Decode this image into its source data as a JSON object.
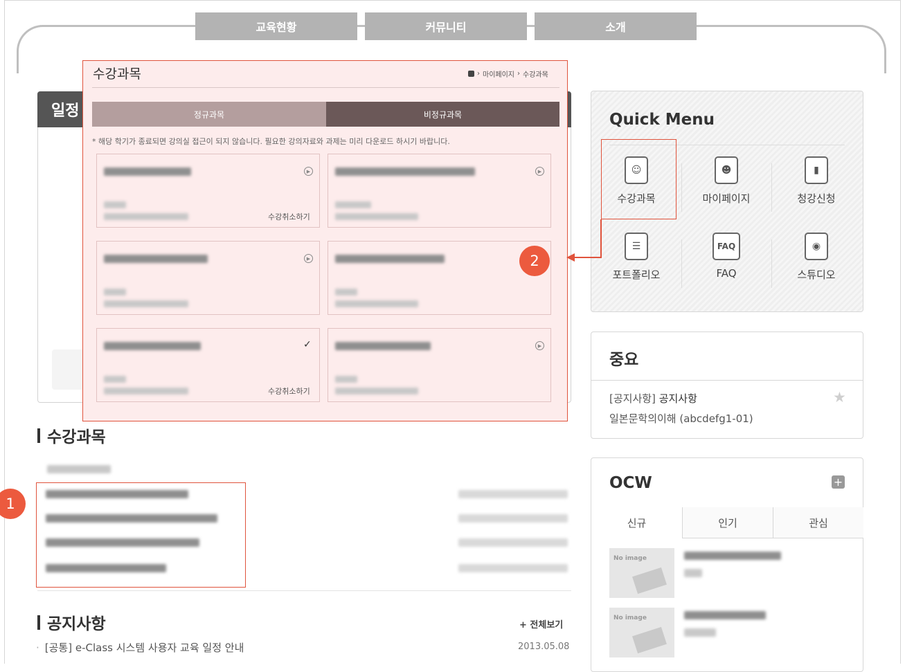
{
  "nav": {
    "tabs": [
      "교육현황",
      "커뮤니티",
      "소개"
    ]
  },
  "schedule": {
    "title": "일정"
  },
  "courses_section": {
    "title": "수강과목"
  },
  "notices": {
    "title": "공지사항",
    "more_label": "+ 전체보기",
    "items": [
      {
        "title": "[공통] e-Class 시스템 사용자 교육 일정 안내",
        "date": "2013.05.08"
      }
    ]
  },
  "popup": {
    "title": "수강과목",
    "breadcrumb": [
      "마이페이지",
      "수강과목"
    ],
    "tabs": [
      "정규과목",
      "비정규과목"
    ],
    "notice": "* 해당 학기가 종료되면 강의실 접근이 되지 않습니다. 필요한 강의자료와 과제는 미리 다운로드 하시기 바랍니다.",
    "cancel_label": "수강취소하기"
  },
  "quick_menu": {
    "title": "Quick Menu",
    "items": [
      {
        "label": "수강과목",
        "icon": "course-icon"
      },
      {
        "label": "마이페이지",
        "icon": "mypage-icon"
      },
      {
        "label": "청강신청",
        "icon": "audit-icon"
      },
      {
        "label": "포트폴리오",
        "icon": "portfolio-icon"
      },
      {
        "label": "FAQ",
        "icon": "faq-icon"
      },
      {
        "label": "스튜디오",
        "icon": "studio-icon"
      }
    ]
  },
  "important": {
    "title": "중요",
    "line1_prefix": "[공지사항]",
    "line1_title": "공지사항",
    "line2": "일본문학의이해 (abcdefg1-01)"
  },
  "ocw": {
    "title": "OCW",
    "tabs": [
      "신규",
      "인기",
      "관심"
    ],
    "no_image_label": "No image"
  },
  "annotations": {
    "badge1": "1",
    "badge2": "2"
  },
  "colors": {
    "highlight": "#e0533c",
    "badge": "#ec5a3e",
    "popup_bg": "#fdecec"
  }
}
